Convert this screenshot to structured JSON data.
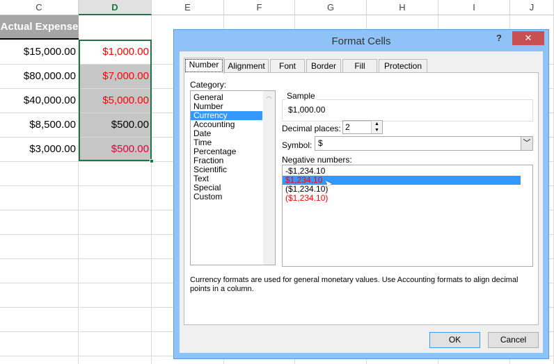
{
  "columns": [
    "C",
    "D",
    "E",
    "F",
    "G",
    "H",
    "I",
    "J"
  ],
  "header_cell": "Actual Expense",
  "rows": [
    {
      "c": "$15,000.00",
      "d": "$1,000.00",
      "d_color": "#ff0000"
    },
    {
      "c": "$80,000.00",
      "d": "$7,000.00",
      "d_color": "#ff0000"
    },
    {
      "c": "$40,000.00",
      "d": "$5,000.00",
      "d_color": "#ff0000"
    },
    {
      "c": "$8,500.00",
      "d": "$500.00",
      "d_color": "#000000"
    },
    {
      "c": "$3,000.00",
      "d": "$500.00",
      "d_color": "#e0003c"
    }
  ],
  "dialog": {
    "title": "Format Cells",
    "help": "?",
    "close": "✕",
    "tabs": [
      "Number",
      "Alignment",
      "Font",
      "Border",
      "Fill",
      "Protection"
    ],
    "category_label": "Category:",
    "categories": [
      "General",
      "Number",
      "Currency",
      "Accounting",
      "Date",
      "Time",
      "Percentage",
      "Fraction",
      "Scientific",
      "Text",
      "Special",
      "Custom"
    ],
    "selected_category": "Currency",
    "sample_label": "Sample",
    "sample_value": "$1,000.00",
    "decimal_label": "Decimal places:",
    "decimal_value": "2",
    "symbol_label": "Symbol:",
    "symbol_value": "$",
    "negative_label": "Negative numbers:",
    "negative_options": [
      {
        "text": "-$1,234.10",
        "color": "#000000"
      },
      {
        "text": "$1,234.10",
        "color": "#ff0000",
        "selected": true
      },
      {
        "text": "($1,234.10)",
        "color": "#000000"
      },
      {
        "text": "($1,234.10)",
        "color": "#ff0000"
      }
    ],
    "description": "Currency formats are used for general monetary values.  Use Accounting formats to align decimal points in a column.",
    "ok": "OK",
    "cancel": "Cancel"
  },
  "colors": {
    "accent": "#217346",
    "selection": "#3399ff",
    "title_bar": "#8fc3f7",
    "close": "#c75050"
  }
}
